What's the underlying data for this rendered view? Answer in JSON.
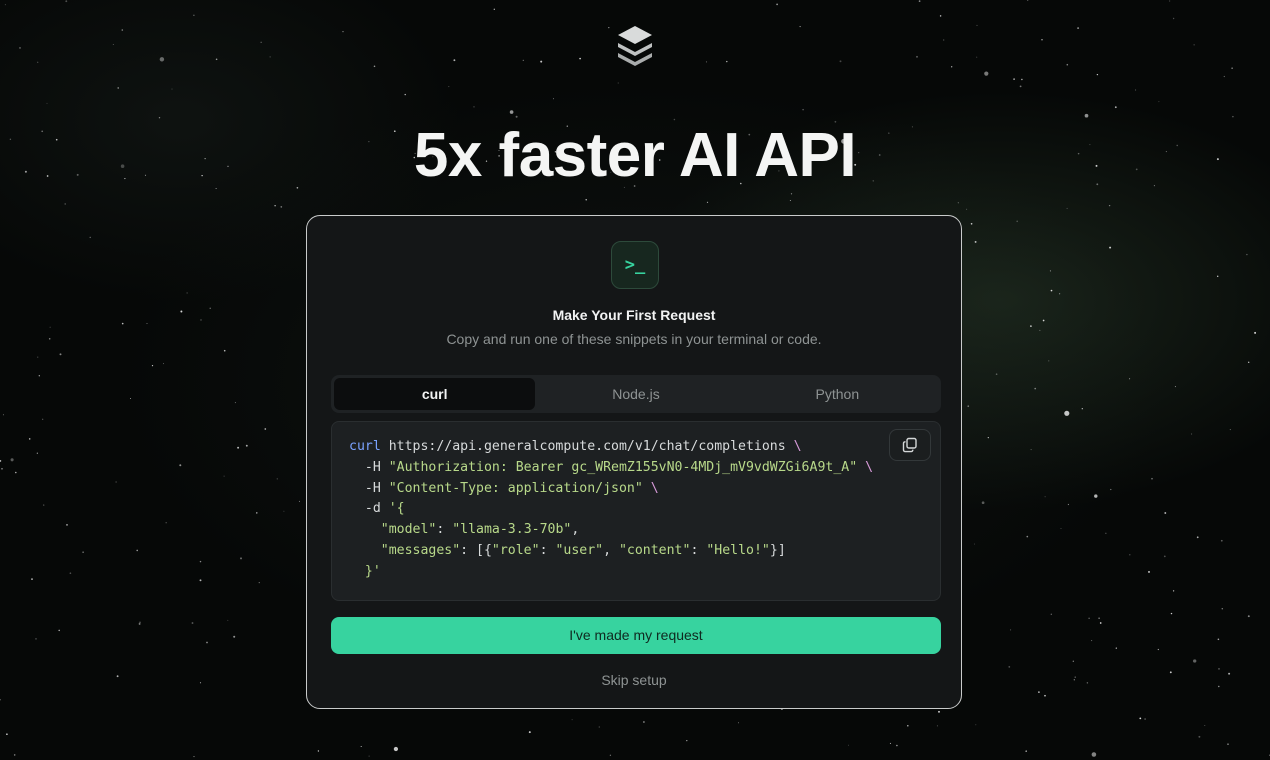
{
  "hero": {
    "logo_icon": "stacked-layers-logo",
    "title": "5x faster AI API"
  },
  "card": {
    "icon": "terminal-icon",
    "icon_glyph": ">_",
    "title": "Make Your First Request",
    "subtitle": "Copy and run one of these snippets in your terminal or code.",
    "tabs": [
      {
        "label": "curl",
        "active": true
      },
      {
        "label": "Node.js",
        "active": false
      },
      {
        "label": "Python",
        "active": false
      }
    ],
    "code": {
      "language": "curl",
      "copy_icon": "copy-icon",
      "lines": {
        "l1_cmd": "curl",
        "l1_url": " https://api.generalcompute.com/v1/chat/completions ",
        "l1_cont": "\\",
        "l2_flag": "  -H ",
        "l2_str": "\"Authorization: Bearer gc_WRemZ155vN0-4MDj_mV9vdWZGi6A9t_A\"",
        "l2_cont": " \\",
        "l3_flag": "  -H ",
        "l3_str": "\"Content-Type: application/json\"",
        "l3_cont": " \\",
        "l4_flag": "  -d ",
        "l4_str": "'{",
        "l5_key": "    \"model\"",
        "l5_colon": ": ",
        "l5_val": "\"llama-3.3-70b\"",
        "l5_comma": ",",
        "l6_key": "    \"messages\"",
        "l6_mid": ": [{",
        "l6_k1": "\"role\"",
        "l6_c1": ": ",
        "l6_v1": "\"user\"",
        "l6_sep": ", ",
        "l6_k2": "\"content\"",
        "l6_c2": ": ",
        "l6_v2": "\"Hello!\"",
        "l6_end": "}]",
        "l7": "  }'"
      }
    },
    "primary_button": "I've made my request",
    "skip_link": "Skip setup"
  },
  "colors": {
    "accent": "#37d39f",
    "card_bg": "#141617",
    "background": "#060807"
  }
}
